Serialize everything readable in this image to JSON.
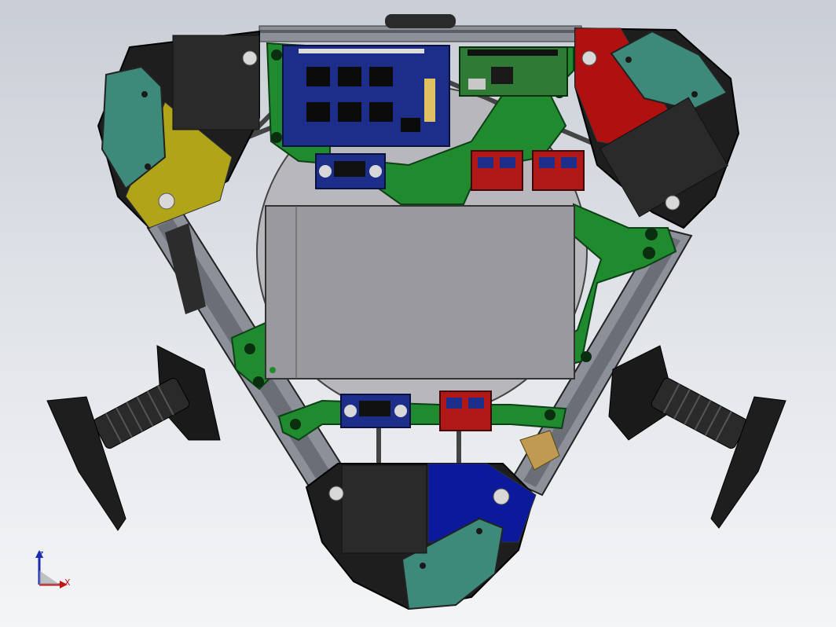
{
  "app": {
    "view": "cad-3d-viewport"
  },
  "triad": {
    "z_label": "Z",
    "x_label": "X"
  },
  "colors": {
    "background_top": "#c9ced6",
    "background_bottom": "#f4f5f7",
    "bracket_green": "#1f8a2e",
    "motor_mount_yellow": "#b0a418",
    "motor_mount_red": "#b01010",
    "motor_mount_blue": "#0a1a9a",
    "carriage_teal": "#3e8a7a",
    "pcb_blue": "#1c2e8a",
    "driver_red": "#b01818",
    "enclosure_gray": "#9a9a9e"
  },
  "parts": [
    "top-left-motor-mount",
    "top-right-motor-mount",
    "bottom-motor-mount",
    "controller-board",
    "single-board-computer",
    "power-enclosure",
    "left-spool-holder",
    "right-spool-holder"
  ]
}
